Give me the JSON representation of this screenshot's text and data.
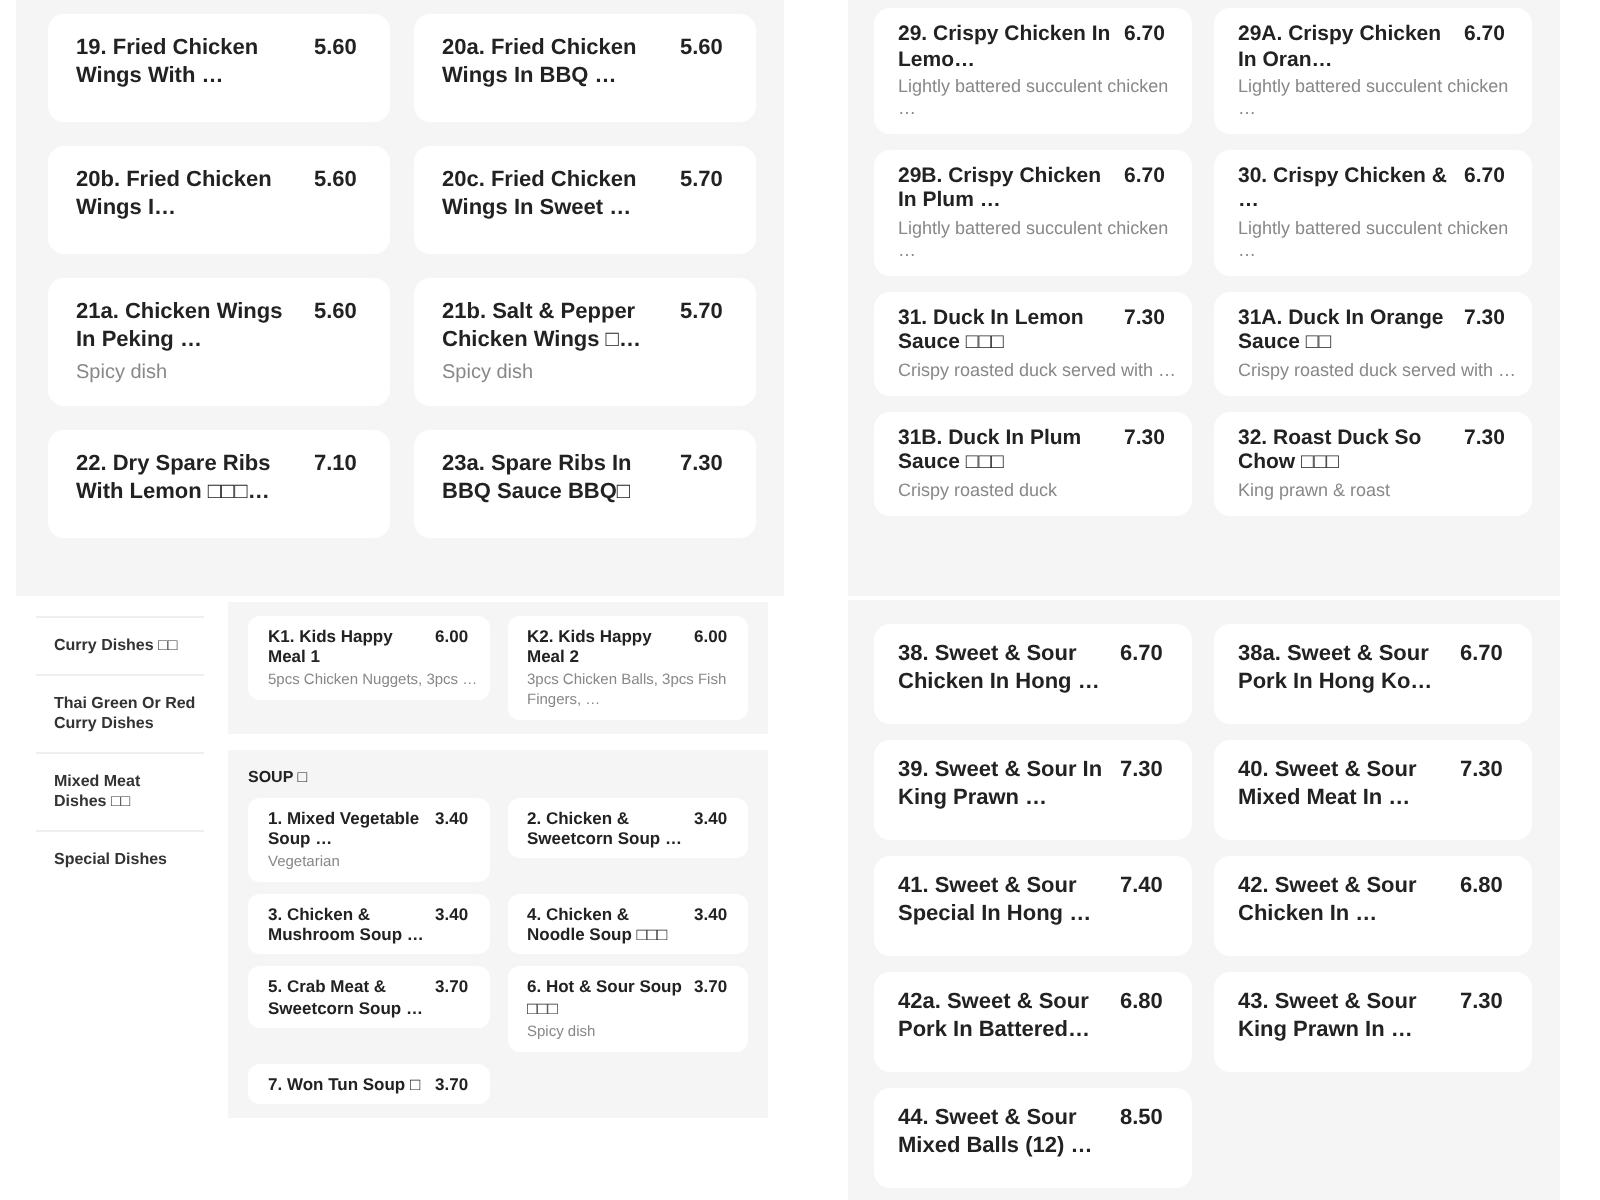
{
  "screens": [
    {
      "kind": "grid",
      "items": [
        {
          "name": "19. Fried Chicken Wings With …",
          "price": "5.60"
        },
        {
          "name": "20a. Fried Chicken Wings In BBQ …",
          "price": "5.60"
        },
        {
          "name": "20b. Fried Chicken Wings I…",
          "price": "5.60"
        },
        {
          "name": "20c. Fried Chicken Wings In Sweet …",
          "price": "5.70"
        },
        {
          "name": "21a. Chicken Wings In Peking …",
          "price": "5.60",
          "description": "Spicy dish"
        },
        {
          "name": "21b. Salt & Pepper Chicken Wings □…",
          "price": "5.70",
          "description": "Spicy dish"
        },
        {
          "name": "22. Dry Spare Ribs With Lemon □□□…",
          "price": "7.10"
        },
        {
          "name": "23a. Spare Ribs In BBQ Sauce BBQ□",
          "price": "7.30"
        }
      ]
    },
    {
      "kind": "grid",
      "items": [
        {
          "name": "29. Crispy Chicken In Lemo…",
          "price": "6.70",
          "description": "Lightly battered succulent chicken …"
        },
        {
          "name": "29A. Crispy Chicken In Oran…",
          "price": "6.70",
          "description": "Lightly battered succulent chicken …"
        },
        {
          "name": "29B. Crispy Chicken In Plum …",
          "price": "6.70",
          "description": "Lightly battered succulent chicken …"
        },
        {
          "name": "30. Crispy Chicken & …",
          "price": "6.70",
          "description": "Lightly battered succulent chicken …"
        },
        {
          "name": "31. Duck In Lemon Sauce □□□",
          "price": "7.30",
          "description": "Crispy roasted duck served with …"
        },
        {
          "name": "31A. Duck In Orange Sauce □□",
          "price": "7.30",
          "description": "Crispy roasted duck served with …"
        },
        {
          "name": "31B. Duck In Plum Sauce □□□",
          "price": "7.30",
          "description": "Crispy roasted duck"
        },
        {
          "name": "32. Roast Duck So Chow □□□",
          "price": "7.30",
          "description": "King prawn & roast"
        }
      ]
    },
    {
      "kind": "sidebar_menu",
      "sidebar": {
        "items": [
          {
            "label": "Curry Dishes □□"
          },
          {
            "label": "Thai Green Or Red Curry Dishes"
          },
          {
            "label": "Mixed Meat Dishes □□"
          },
          {
            "label": "Special Dishes"
          }
        ]
      },
      "sections": [
        {
          "items": [
            {
              "name": "K1. Kids Happy Meal 1",
              "price": "6.00",
              "description": "5pcs Chicken Nuggets, 3pcs …"
            },
            {
              "name": "K2. Kids Happy Meal 2",
              "price": "6.00",
              "description": "3pcs Chicken Balls, 3pcs Fish Fingers, …"
            }
          ]
        },
        {
          "title": "SOUP □",
          "items": [
            {
              "name": "1. Mixed Vegetable Soup …",
              "price": "3.40",
              "description": "Vegetarian"
            },
            {
              "name": "2. Chicken & Sweetcorn Soup …",
              "price": "3.40"
            },
            {
              "name": "3. Chicken & Mushroom Soup …",
              "price": "3.40"
            },
            {
              "name": "4. Chicken & Noodle Soup □□□",
              "price": "3.40"
            },
            {
              "name": "5. Crab Meat & Sweetcorn Soup …",
              "price": "3.70"
            },
            {
              "name": "6. Hot & Sour Soup □□□",
              "price": "3.70",
              "description": "Spicy dish"
            },
            {
              "name": "7. Won Tun Soup □",
              "price": "3.70"
            }
          ]
        }
      ]
    },
    {
      "kind": "grid",
      "items": [
        {
          "name": "38. Sweet & Sour Chicken In Hong …",
          "price": "6.70"
        },
        {
          "name": "38a. Sweet & Sour Pork In Hong Ko…",
          "price": "6.70"
        },
        {
          "name": "39. Sweet & Sour In King Prawn …",
          "price": "7.30"
        },
        {
          "name": "40. Sweet & Sour Mixed Meat In …",
          "price": "7.30"
        },
        {
          "name": "41. Sweet & Sour Special In Hong …",
          "price": "7.40"
        },
        {
          "name": "42. Sweet & Sour Chicken In …",
          "price": "6.80"
        },
        {
          "name": "42a. Sweet & Sour Pork In Battered…",
          "price": "6.80"
        },
        {
          "name": "43. Sweet & Sour King Prawn In …",
          "price": "7.30"
        },
        {
          "name": "44. Sweet & Sour Mixed Balls (12) …",
          "price": "8.50"
        }
      ]
    }
  ]
}
